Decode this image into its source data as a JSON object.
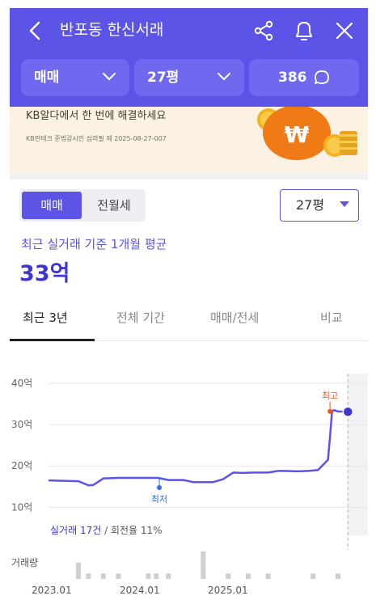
{
  "header": {
    "title": "반포동 한신서래",
    "filters": {
      "trade_type": "매매",
      "size": "27평",
      "comments": "386"
    }
  },
  "banner": {
    "text": "KB알다에서 한 번에 해결하세요",
    "legal": "KB핀테크 준법감시인 심의필 제 2025-08-27-007"
  },
  "toggle": {
    "option_sale": "매매",
    "option_rent": "전월세"
  },
  "size_select": {
    "value": "27평"
  },
  "summary": {
    "subtitle": "최근 실거래 기준 1개월 평균",
    "price": "33억"
  },
  "tabs": [
    "최근 3년",
    "전체 기간",
    "매매/전세",
    "비교"
  ],
  "chart_text": {
    "max_label": "최고",
    "min_label": "최저",
    "trades_prefix": "실거래 ",
    "trades_count": "17건",
    "turnover": " / 회전율 11%",
    "volume_label": "거래량"
  },
  "colors": {
    "accent": "#5b54e6",
    "max_marker": "#e8572a",
    "min_marker": "#2a6ee8"
  },
  "chart_data": {
    "type": "line",
    "y_ticks": [
      "40억",
      "30억",
      "20억",
      "10억"
    ],
    "y_values": [
      40,
      30,
      20,
      10
    ],
    "ylim": [
      8.5,
      40
    ],
    "x_ticks": [
      "2023.01",
      "2024.01",
      "2025.01"
    ],
    "x_tick_values": [
      2023.0,
      2024.0,
      2025.0
    ],
    "xlim": [
      2022.8,
      2026.0
    ],
    "series": [
      {
        "x": [
          2022.8,
          2023.1,
          2023.2,
          2023.25,
          2023.35,
          2023.5,
          2023.8,
          2023.9,
          2024.0,
          2024.15,
          2024.25,
          2024.35,
          2024.45,
          2024.55,
          2024.65,
          2024.75,
          2024.85,
          2025.0,
          2025.1,
          2025.15,
          2025.3,
          2025.4,
          2025.5,
          2025.6,
          2025.62,
          2025.64,
          2025.66,
          2025.7,
          2025.8
        ],
        "y": [
          16.5,
          16.3,
          15.3,
          15.4,
          17.0,
          17.1,
          17.1,
          17.1,
          16.6,
          16.6,
          16.1,
          16.1,
          16.1,
          16.8,
          18.4,
          18.3,
          18.4,
          18.4,
          18.8,
          18.8,
          18.7,
          18.8,
          19.0,
          21.5,
          27.0,
          33.2,
          33.5,
          33.2,
          33.1
        ]
      }
    ],
    "max_point": {
      "x": 2025.62,
      "y": 33.2
    },
    "min_point": {
      "x": 2023.91,
      "y": 17.1
    },
    "current_point": {
      "x": 2025.8,
      "y": 33.1
    },
    "volume": {
      "x": [
        2023.1,
        2023.2,
        2023.35,
        2023.5,
        2023.8,
        2023.88,
        2024.0,
        2024.35,
        2024.6,
        2024.8,
        2025.0,
        2025.45,
        2025.7
      ],
      "values": [
        3,
        1,
        1,
        1,
        1,
        1,
        1,
        5,
        1,
        1,
        1,
        1,
        1
      ]
    }
  }
}
